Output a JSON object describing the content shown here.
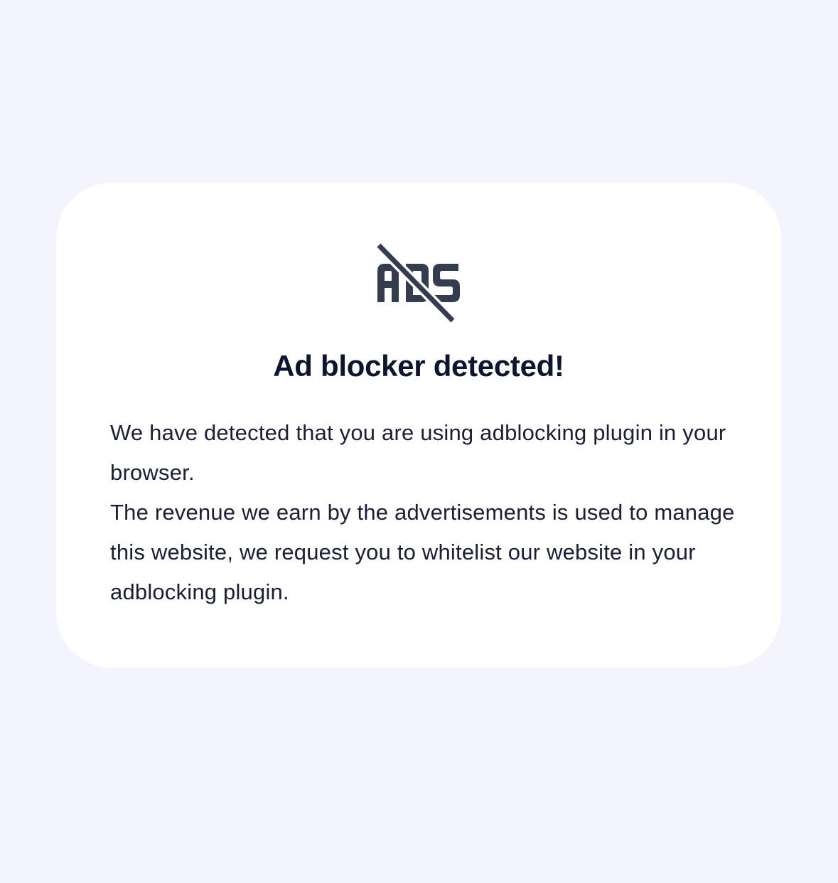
{
  "colors": {
    "page_background": "#f3f4fd",
    "card_background": "#ffffff",
    "title_text": "#0e1531",
    "body_text": "#1a1f38",
    "icon": "#343d4f"
  },
  "icon": {
    "name": "ads-blocked-icon",
    "glyph_text": "ADS"
  },
  "dialog": {
    "title": "Ad blocker detected!",
    "paragraphs": [
      "We have detected that you are using adblocking plugin in your browser.",
      "The revenue we earn by the advertisements is used to manage this website, we request you to whitelist our website in your adblocking plugin."
    ]
  }
}
